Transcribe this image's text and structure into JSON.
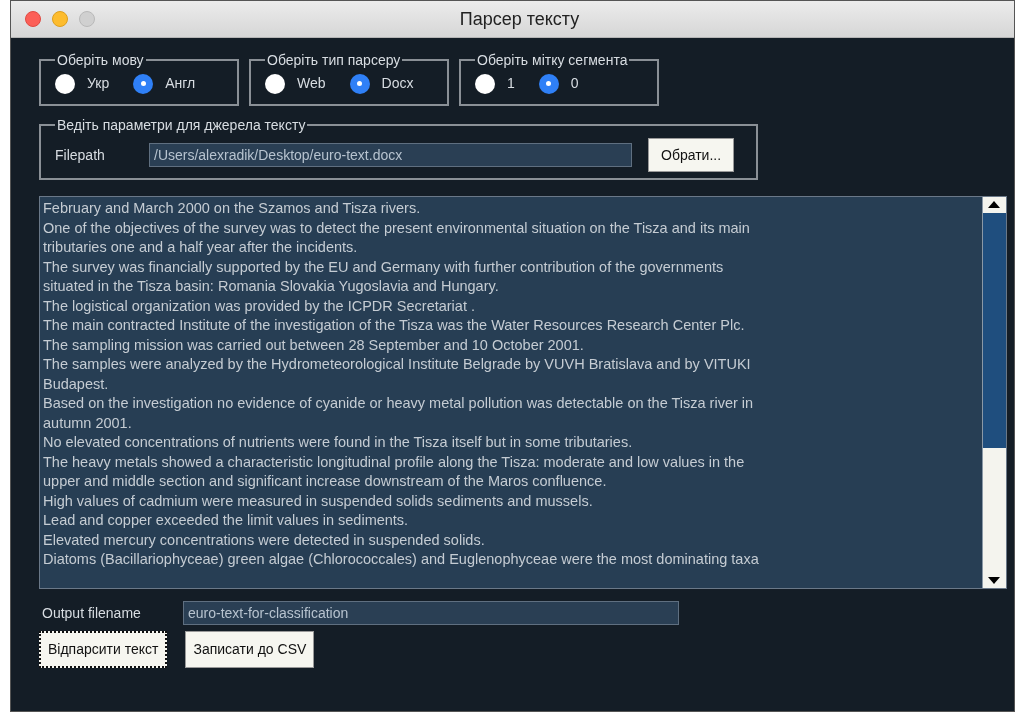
{
  "window": {
    "title": "Парсер тексту"
  },
  "option_groups": [
    {
      "legend": "Оберіть мову",
      "options": [
        {
          "label": "Укр",
          "selected": false
        },
        {
          "label": "Англ",
          "selected": true
        }
      ]
    },
    {
      "legend": "Оберіть тип парсеру",
      "options": [
        {
          "label": "Web",
          "selected": false
        },
        {
          "label": "Docx",
          "selected": true
        }
      ]
    },
    {
      "legend": "Оберіть мітку сегмента",
      "options": [
        {
          "label": "1",
          "selected": false
        },
        {
          "label": "0",
          "selected": true
        }
      ]
    }
  ],
  "source": {
    "legend": "Ведіть параметри для джерела тексту",
    "label": "Filepath",
    "value": "/Users/alexradik/Desktop/euro-text.docx",
    "button": "Обрати..."
  },
  "text_area": {
    "lines": [
      "February and March 2000 on the Szamos and Tisza rivers.",
      "One of the objectives of the survey was to detect the present environmental situation on the Tisza and its main",
      "tributaries one and a half year after the incidents.",
      "The survey was financially supported by the EU and Germany with further contribution of the governments",
      "situated in the Tisza basin: Romania Slovakia Yugoslavia and Hungary.",
      "The logistical organization was provided by the ICPDR Secretariat .",
      "The main contracted Institute of the investigation of the Tisza was the Water Resources Research Center Plc.",
      "The sampling mission was carried out between 28 September and 10 October 2001.",
      "The samples were analyzed by the Hydrometeorological Institute Belgrade by VUVH Bratislava and by VITUKI",
      "Budapest.",
      "Based on the investigation no evidence of cyanide or heavy metal pollution was detectable on the Tisza river in",
      "autumn 2001.",
      "No elevated concentrations of nutrients were found in the Tisza itself but in some tributaries.",
      "The heavy metals showed a characteristic longitudinal profile along the Tisza: moderate and low values in the",
      "upper and middle section and significant increase downstream of the Maros confluence.",
      "High values of cadmium were measured in suspended solids sediments and mussels.",
      "Lead and copper exceeded the limit values in sediments.",
      "Elevated mercury concentrations were detected in suspended solids.",
      "Diatoms (Bacillariophyceae) green algae (Chlorococcales) and Euglenophyceae were the most dominating taxa"
    ]
  },
  "output": {
    "label": "Output filename",
    "value": "euro-text-for-classification"
  },
  "buttons": [
    {
      "label": "Відпарсити текст",
      "focused": true
    },
    {
      "label": "Записати до CSV",
      "focused": false
    }
  ]
}
